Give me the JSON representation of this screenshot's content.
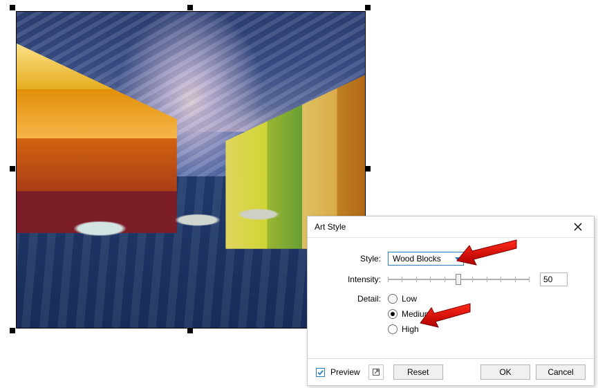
{
  "dialog": {
    "title": "Art Style",
    "style_label": "Style:",
    "style_value": "Wood Blocks",
    "intensity_label": "Intensity:",
    "intensity_value": "50",
    "intensity_min": 0,
    "intensity_max": 100,
    "detail_label": "Detail:",
    "detail_options": {
      "low": "Low",
      "medium": "Medium",
      "high": "High"
    },
    "detail_selected": "medium",
    "preview_label": "Preview",
    "preview_checked": true,
    "reset_label": "Reset",
    "ok_label": "OK",
    "cancel_label": "Cancel"
  },
  "annotations": {
    "arrow1_target": "style-dropdown",
    "arrow2_target": "detail-medium"
  }
}
